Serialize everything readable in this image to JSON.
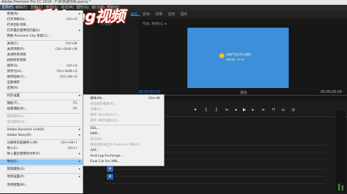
{
  "titlebar": {
    "title": "Adobe Premiere Pro CC 2018 - F:\\B\\新建项目.prproj *"
  },
  "menubar": {
    "items": [
      "文件(F)",
      "编辑(E)",
      "剪辑(C)",
      "序列(S)",
      "标记(M)",
      "图形(G)",
      "窗口(W)",
      "帮助(H)"
    ]
  },
  "workspace": {
    "tabs": [
      "组件",
      "编辑",
      "颜色",
      "效果",
      "音频",
      "图形"
    ],
    "current": "编辑"
  },
  "panels": {
    "left_label": "无标题",
    "program_label": "节目: 序列01 ≡",
    "tc_left": "00;00;02;15",
    "fit": "适合",
    "tc_right": "00;00;05;00"
  },
  "video": {
    "logo_text": "网络IT培训中心教程",
    "logo_sub": "制作日期：2018年..."
  },
  "watermark": {
    "text": "彩dong视频"
  },
  "file_menu": {
    "items": [
      {
        "label": "新建(N)",
        "shortcut": "",
        "arrow": "▸",
        "disabled": false
      },
      {
        "label": "打开项目(O)...",
        "shortcut": "Ctrl+O",
        "arrow": "",
        "disabled": false
      },
      {
        "label": "打开团队项目...",
        "shortcut": "",
        "arrow": "",
        "disabled": false
      },
      {
        "label": "打开最近使用的内容(E)",
        "shortcut": "",
        "arrow": "▸",
        "disabled": false
      },
      {
        "label": "转换 Premiere Clip 项目(C)...",
        "shortcut": "",
        "arrow": "",
        "disabled": false
      },
      {
        "label": "关闭(C)",
        "shortcut": "Ctrl+W",
        "arrow": "",
        "disabled": false
      },
      {
        "label": "关闭项目(P)",
        "shortcut": "Ctrl+Shift+W",
        "arrow": "",
        "disabled": false
      },
      {
        "label": "关闭所有项目",
        "shortcut": "",
        "arrow": "",
        "disabled": false
      },
      {
        "label": "刷新所有项目",
        "shortcut": "",
        "arrow": "",
        "disabled": false
      },
      {
        "label": "保存(S)",
        "shortcut": "Ctrl+S",
        "arrow": "",
        "disabled": false
      },
      {
        "label": "另存为(A)...",
        "shortcut": "Ctrl+Shift+S",
        "arrow": "",
        "disabled": false
      },
      {
        "label": "保存副本(Y)...",
        "shortcut": "Ctrl+Alt+S",
        "arrow": "",
        "disabled": false
      },
      {
        "label": "全部保存",
        "shortcut": "",
        "arrow": "",
        "disabled": false
      },
      {
        "label": "还原(R)",
        "shortcut": "",
        "arrow": "",
        "disabled": false
      },
      {
        "label": "同步设置",
        "shortcut": "",
        "arrow": "▸",
        "disabled": false
      },
      {
        "label": "捕捉(T)...",
        "shortcut": "F5",
        "arrow": "",
        "disabled": false
      },
      {
        "label": "批量捕捉(B)...",
        "shortcut": "F6",
        "arrow": "",
        "disabled": false
      },
      {
        "label": "链接媒体(L)...",
        "shortcut": "",
        "arrow": "",
        "disabled": true
      },
      {
        "label": "设为脱机(O)...",
        "shortcut": "",
        "arrow": "",
        "disabled": true
      },
      {
        "label": "Adobe Dynamic Link(K)",
        "shortcut": "",
        "arrow": "▸",
        "disabled": false
      },
      {
        "label": "Adobe Story(R)",
        "shortcut": "",
        "arrow": "▸",
        "disabled": false
      },
      {
        "label": "从媒体浏览器导入(M)",
        "shortcut": "Ctrl+Alt+I",
        "arrow": "",
        "disabled": false
      },
      {
        "label": "导入(I)...",
        "shortcut": "Ctrl+I",
        "arrow": "",
        "disabled": false
      },
      {
        "label": "导入最近使用的文件(F)",
        "shortcut": "",
        "arrow": "▸",
        "disabled": false
      },
      {
        "label": "导出(E)",
        "shortcut": "",
        "arrow": "▸",
        "disabled": false
      },
      {
        "label": "获取属性(G)",
        "shortcut": "",
        "arrow": "▸",
        "disabled": false
      },
      {
        "label": "项目设置(P)",
        "shortcut": "",
        "arrow": "▸",
        "disabled": false
      },
      {
        "label": "项目管理(M)...",
        "shortcut": "",
        "arrow": "",
        "disabled": false
      }
    ]
  },
  "export_submenu": {
    "items": [
      {
        "label": "媒体(M)...",
        "shortcut": "Ctrl+M",
        "disabled": false
      },
      {
        "label": "动态图形模板(R)...",
        "shortcut": "",
        "disabled": true
      },
      {
        "label": "字幕(C)...",
        "shortcut": "",
        "disabled": true
      },
      {
        "label": "磁带 (DV/HDV)(T)...",
        "shortcut": "",
        "disabled": true
      },
      {
        "label": "磁带 (串行设备)(S)...",
        "shortcut": "",
        "disabled": true
      },
      {
        "label": "EDL...",
        "shortcut": "",
        "disabled": false
      },
      {
        "label": "OMF...",
        "shortcut": "",
        "disabled": false
      },
      {
        "label": "标记(M)...",
        "shortcut": "",
        "disabled": true
      },
      {
        "label": "将选择项导出为 Premiere 项目(S)...",
        "shortcut": "",
        "disabled": true
      },
      {
        "label": "AAF...",
        "shortcut": "",
        "disabled": false
      },
      {
        "label": "Avid Log Exchange...",
        "shortcut": "",
        "disabled": false
      },
      {
        "label": "Final Cut Pro XML...",
        "shortcut": "",
        "disabled": false
      }
    ]
  }
}
